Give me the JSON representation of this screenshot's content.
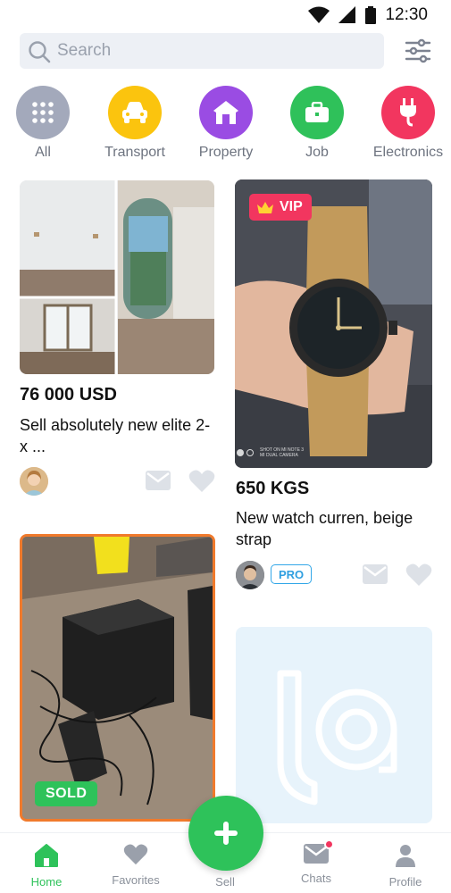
{
  "status_bar": {
    "time": "12:30"
  },
  "search": {
    "placeholder": "Search"
  },
  "categories": [
    {
      "label": "All",
      "color": "#a3a9bb",
      "icon": "grid-icon"
    },
    {
      "label": "Transport",
      "color": "#fbc40e",
      "icon": "car-icon"
    },
    {
      "label": "Property",
      "color": "#9a4ce3",
      "icon": "house-icon"
    },
    {
      "label": "Job",
      "color": "#2fc15a",
      "icon": "briefcase-icon"
    },
    {
      "label": "Electronics",
      "color": "#f2365f",
      "icon": "plug-icon"
    }
  ],
  "listings": [
    {
      "price": "76 000 USD",
      "title": "Sell absolutely new elite 2-x ..."
    },
    {
      "badge": "VIP",
      "price": "650 KGS",
      "title": "New watch curren, beige strap",
      "seller_badge": "PRO",
      "photo_caption_line1": "SHOT ON MI NOTE 3",
      "photo_caption_line2": "MI DUAL CAMERA"
    },
    {
      "badge": "SOLD"
    },
    {
      "placeholder_icon": "brand-logo-placeholder"
    }
  ],
  "bottom_nav": {
    "items": [
      {
        "label": "Home",
        "icon": "home-icon",
        "active": true
      },
      {
        "label": "Favorites",
        "icon": "heart-icon"
      },
      {
        "label": "Sell",
        "icon": "plus-icon"
      },
      {
        "label": "Chats",
        "icon": "mail-icon",
        "has_notification": true
      },
      {
        "label": "Profile",
        "icon": "person-icon"
      }
    ]
  },
  "colors": {
    "accent": "#2ec25a",
    "vip": "#f2365f",
    "pro": "#32a7e8",
    "sold_border": "#f07a2c"
  }
}
